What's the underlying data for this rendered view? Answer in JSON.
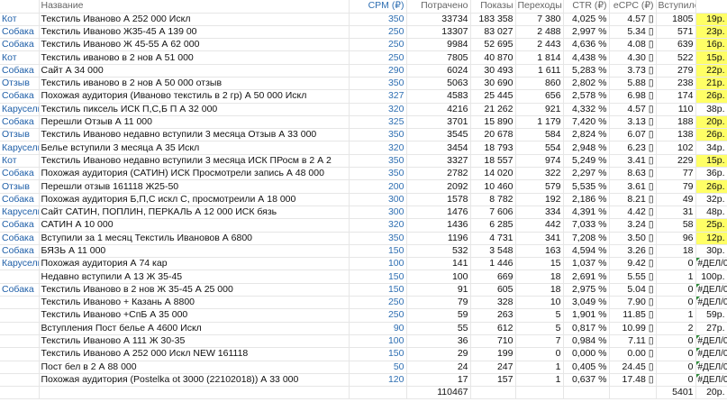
{
  "headers": {
    "tag": "",
    "name": "Название",
    "cpm": "CPM (₽)",
    "spent": "Потрачено",
    "impressions": "Показы",
    "clicks": "Переходы",
    "ctr": "CTR (₽)",
    "ecpc": "eCPC (₽)",
    "joined": "Вступило",
    "cpa": ""
  },
  "rows": [
    {
      "tag": "Кот",
      "name": "Текстиль Иваново А 252 000 Искл",
      "cpm": "350",
      "spent": "33734",
      "impressions": "183 358",
      "clicks": "7 380",
      "ctr": "4,025 %",
      "ecpc": "4.57 ▯",
      "joined": "1805",
      "cpa": "19р.",
      "highlight": true,
      "mark": false
    },
    {
      "tag": "Собака",
      "name": "Текстиль Иваново Ж35-45 А 139 00",
      "cpm": "250",
      "spent": "13307",
      "impressions": "83 027",
      "clicks": "2 488",
      "ctr": "2,997 %",
      "ecpc": "5.34 ▯",
      "joined": "571",
      "cpa": "23р.",
      "highlight": true,
      "mark": false
    },
    {
      "tag": "Собака",
      "name": "Текстиль Иваново Ж 45-55 А 62 000",
      "cpm": "250",
      "spent": "9984",
      "impressions": "52 695",
      "clicks": "2 443",
      "ctr": "4,636 %",
      "ecpc": "4.08 ▯",
      "joined": "639",
      "cpa": "16р.",
      "highlight": true,
      "mark": false
    },
    {
      "tag": "Кот",
      "name": "Текстиль иваново в 2 нов А 51 000",
      "cpm": "250",
      "spent": "7805",
      "impressions": "40 870",
      "clicks": "1 814",
      "ctr": "4,438 %",
      "ecpc": "4.30 ▯",
      "joined": "522",
      "cpa": "15р.",
      "highlight": true,
      "mark": false
    },
    {
      "tag": "Собака",
      "name": "Сайт А 34 000",
      "cpm": "290",
      "spent": "6024",
      "impressions": "30 493",
      "clicks": "1 611",
      "ctr": "5,283 %",
      "ecpc": "3.73 ▯",
      "joined": "279",
      "cpa": "22р.",
      "highlight": true,
      "mark": false
    },
    {
      "tag": "Отзыв",
      "name": "Текстиль иваново в 2 нов А 50 000 отзыв",
      "cpm": "350",
      "spent": "5063",
      "impressions": "30 690",
      "clicks": "860",
      "ctr": "2,802 %",
      "ecpc": "5.88 ▯",
      "joined": "238",
      "cpa": "21р.",
      "highlight": true,
      "mark": false
    },
    {
      "tag": "Собака",
      "name": "Похожая аудитория (Иваново текстиль в 2 гр) А 50 000 Искл",
      "cpm": "327",
      "spent": "4583",
      "impressions": "25 445",
      "clicks": "656",
      "ctr": "2,578 %",
      "ecpc": "6.98 ▯",
      "joined": "174",
      "cpa": "26р.",
      "highlight": true,
      "mark": false
    },
    {
      "tag": "Карусель",
      "name": "Текстиль пиксель ИСК П,С,Б П А 32 000",
      "cpm": "320",
      "spent": "4216",
      "impressions": "21 262",
      "clicks": "921",
      "ctr": "4,332 %",
      "ecpc": "4.57 ▯",
      "joined": "110",
      "cpa": "38р.",
      "highlight": false,
      "mark": false
    },
    {
      "tag": "Собака",
      "name": "Перешли Отзыв А 11 000",
      "cpm": "325",
      "spent": "3701",
      "impressions": "15 890",
      "clicks": "1 179",
      "ctr": "7,420 %",
      "ecpc": "3.13 ▯",
      "joined": "188",
      "cpa": "20р.",
      "highlight": true,
      "mark": false
    },
    {
      "tag": "Отзыв",
      "name": "Текстиль Иваново недавно вступили 3 месяца Отзыв А 33 000",
      "cpm": "350",
      "spent": "3545",
      "impressions": "20 678",
      "clicks": "584",
      "ctr": "2,824 %",
      "ecpc": "6.07 ▯",
      "joined": "138",
      "cpa": "26р.",
      "highlight": true,
      "mark": false
    },
    {
      "tag": "Карусель",
      "name": "Белье вступили 3 месяца А 35 Искл",
      "cpm": "320",
      "spent": "3454",
      "impressions": "18 793",
      "clicks": "554",
      "ctr": "2,948 %",
      "ecpc": "6.23 ▯",
      "joined": "102",
      "cpa": "34р.",
      "highlight": false,
      "mark": false
    },
    {
      "tag": "Кот",
      "name": "Текстиль Иваново недавно вступили 3 месяца ИСК ПРосм в 2 А 2",
      "cpm": "350",
      "spent": "3327",
      "impressions": "18 557",
      "clicks": "974",
      "ctr": "5,249 %",
      "ecpc": "3.41 ▯",
      "joined": "229",
      "cpa": "15р.",
      "highlight": true,
      "mark": false
    },
    {
      "tag": "Собака",
      "name": "Похожая аудитория (САТИН) ИСК Просмотрели запись А 48 000",
      "cpm": "350",
      "spent": "2782",
      "impressions": "14 020",
      "clicks": "322",
      "ctr": "2,297 %",
      "ecpc": "8.63 ▯",
      "joined": "77",
      "cpa": "36р.",
      "highlight": false,
      "mark": false
    },
    {
      "tag": "Отзыв",
      "name": "Перешли отзыв 161118 Ж25-50",
      "cpm": "200",
      "spent": "2092",
      "impressions": "10 460",
      "clicks": "579",
      "ctr": "5,535 %",
      "ecpc": "3.61 ▯",
      "joined": "79",
      "cpa": "26р.",
      "highlight": true,
      "mark": false
    },
    {
      "tag": "Собака",
      "name": "Похожая аудитория Б,П,С искл С, просмотреили А 18 000",
      "cpm": "300",
      "spent": "1578",
      "impressions": "8 782",
      "clicks": "192",
      "ctr": "2,186 %",
      "ecpc": "8.21 ▯",
      "joined": "49",
      "cpa": "32р.",
      "highlight": false,
      "mark": false
    },
    {
      "tag": "Карусель",
      "name": "Сайт САТИН, ПОПЛИН, ПЕРКАЛЬ А 12 000 ИСК бязь",
      "cpm": "300",
      "spent": "1476",
      "impressions": "7 606",
      "clicks": "334",
      "ctr": "4,391 %",
      "ecpc": "4.42 ▯",
      "joined": "31",
      "cpa": "48р.",
      "highlight": false,
      "mark": false
    },
    {
      "tag": "Собака",
      "name": "САТИН А 10 000",
      "cpm": "320",
      "spent": "1436",
      "impressions": "6 285",
      "clicks": "442",
      "ctr": "7,033 %",
      "ecpc": "3.24 ▯",
      "joined": "58",
      "cpa": "25р.",
      "highlight": true,
      "mark": false
    },
    {
      "tag": "Собака",
      "name": "Вступили за 1 месяц Текстиль Ивановов А 6800",
      "cpm": "350",
      "spent": "1196",
      "impressions": "4 731",
      "clicks": "341",
      "ctr": "7,208 %",
      "ecpc": "3.50 ▯",
      "joined": "96",
      "cpa": "12р.",
      "highlight": true,
      "mark": false
    },
    {
      "tag": "Собака",
      "name": "БЯЗЬ А 11 000",
      "cpm": "150",
      "spent": "532",
      "impressions": "3 548",
      "clicks": "163",
      "ctr": "4,594 %",
      "ecpc": "3.26 ▯",
      "joined": "18",
      "cpa": "30р.",
      "highlight": false,
      "mark": false
    },
    {
      "tag": "Карусель",
      "name": "Похожая аудитория А 74 кар",
      "cpm": "100",
      "spent": "141",
      "impressions": "1 446",
      "clicks": "15",
      "ctr": "1,037 %",
      "ecpc": "9.42 ▯",
      "joined": "0",
      "cpa": "#ДЕЛ/0!",
      "highlight": false,
      "mark": true
    },
    {
      "tag": "",
      "name": "Недавно вступили А 13 Ж 35-45",
      "cpm": "150",
      "spent": "100",
      "impressions": "669",
      "clicks": "18",
      "ctr": "2,691 %",
      "ecpc": "5.55 ▯",
      "joined": "1",
      "cpa": "100р.",
      "highlight": false,
      "mark": false
    },
    {
      "tag": "Собака",
      "name": "Текстиль Иваново в 2 нов Ж 35-45 А 25 000",
      "cpm": "150",
      "spent": "91",
      "impressions": "605",
      "clicks": "18",
      "ctr": "2,975 %",
      "ecpc": "5.04 ▯",
      "joined": "0",
      "cpa": "#ДЕЛ/0!",
      "highlight": false,
      "mark": true
    },
    {
      "tag": "",
      "name": "Текстиль Иваново + Казань А 8800",
      "cpm": "250",
      "spent": "79",
      "impressions": "328",
      "clicks": "10",
      "ctr": "3,049 %",
      "ecpc": "7.90 ▯",
      "joined": "0",
      "cpa": "#ДЕЛ/0!",
      "highlight": false,
      "mark": true
    },
    {
      "tag": "",
      "name": "Текстиль Иваново +СпБ А 35 000",
      "cpm": "250",
      "spent": "59",
      "impressions": "263",
      "clicks": "5",
      "ctr": "1,901 %",
      "ecpc": "11.85 ▯",
      "joined": "1",
      "cpa": "59р.",
      "highlight": false,
      "mark": false
    },
    {
      "tag": "",
      "name": "Вступления Пост белье А 4600 Искл",
      "cpm": "90",
      "spent": "55",
      "impressions": "612",
      "clicks": "5",
      "ctr": "0,817 %",
      "ecpc": "10.99 ▯",
      "joined": "2",
      "cpa": "27р.",
      "highlight": false,
      "mark": false
    },
    {
      "tag": "",
      "name": "Текстиль Иваново А 111 Ж 30-35",
      "cpm": "100",
      "spent": "36",
      "impressions": "710",
      "clicks": "7",
      "ctr": "0,984 %",
      "ecpc": "7.11 ▯",
      "joined": "0",
      "cpa": "#ДЕЛ/0!",
      "highlight": false,
      "mark": true
    },
    {
      "tag": "",
      "name": "Текстиль Иваново А 252 000 Искл NEW 161118",
      "cpm": "150",
      "spent": "29",
      "impressions": "199",
      "clicks": "0",
      "ctr": "0,000 %",
      "ecpc": "0.00 ▯",
      "joined": "0",
      "cpa": "#ДЕЛ/0!",
      "highlight": false,
      "mark": true
    },
    {
      "tag": "",
      "name": "Пост бел в 2 А 88 000",
      "cpm": "50",
      "spent": "24",
      "impressions": "247",
      "clicks": "1",
      "ctr": "0,405 %",
      "ecpc": "24.45 ▯",
      "joined": "0",
      "cpa": "#ДЕЛ/0!",
      "highlight": false,
      "mark": true
    },
    {
      "tag": "",
      "name": "Похожая аудитория (Postelka ot 3000 (22102018)) А 33 000",
      "cpm": "120",
      "spent": "17",
      "impressions": "157",
      "clicks": "1",
      "ctr": "0,637 %",
      "ecpc": "17.48 ▯",
      "joined": "0",
      "cpa": "#ДЕЛ/0!",
      "highlight": false,
      "mark": true
    }
  ],
  "totals": {
    "spent": "110467",
    "joined": "5401",
    "cpa": "20р."
  },
  "colors": {
    "highlight": "#ffff66",
    "tag_text": "#1f5fa8",
    "cpm_text": "#2f6fb2"
  }
}
